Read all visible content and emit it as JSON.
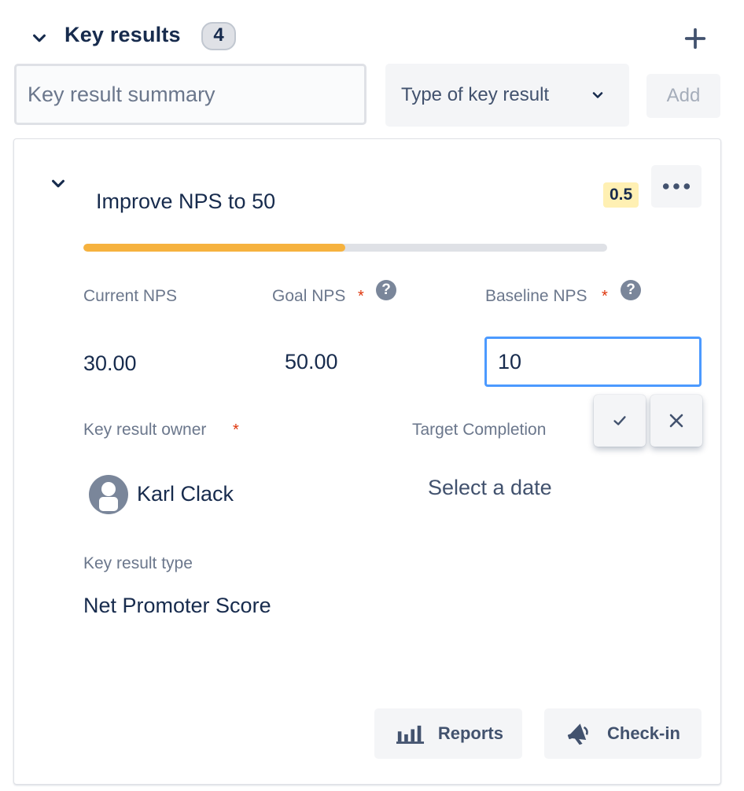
{
  "header": {
    "title": "Key results",
    "count": "4"
  },
  "add_row": {
    "summary_placeholder": "Key result summary",
    "summary_value": "",
    "type_select_label": "Type of key result",
    "add_label": "Add"
  },
  "key_result": {
    "name": "Improve NPS to 50",
    "score": "0.5",
    "progress_fraction": 0.5,
    "progress_color": "#f6b23e",
    "fields": {
      "current_label": "Current NPS",
      "current_value": "30.00",
      "goal_label": "Goal NPS",
      "goal_value": "50.00",
      "baseline_label": "Baseline NPS",
      "baseline_value": "10",
      "required_mark": "*",
      "help_mark": "?"
    },
    "owner_label": "Key result owner",
    "owner_name": "Karl Clack",
    "target_label": "Target Completion",
    "target_value": "Select a date",
    "type_label": "Key result type",
    "type_value": "Net Promoter Score"
  },
  "footer": {
    "reports_label": "Reports",
    "checkin_label": "Check-in"
  },
  "icons": {
    "collapse": "chevron-down-icon",
    "add": "plus-icon",
    "more": "more-horizontal-icon",
    "help": "question-circle-icon",
    "confirm": "check-icon",
    "cancel": "close-icon",
    "reports": "bar-chart-icon",
    "checkin": "megaphone-icon"
  },
  "colors": {
    "text_primary": "#172b4d",
    "text_subtle": "#6b778c",
    "required": "#de350b",
    "focus_border": "#4c9aff",
    "score_badge_bg": "#fff0b3"
  }
}
